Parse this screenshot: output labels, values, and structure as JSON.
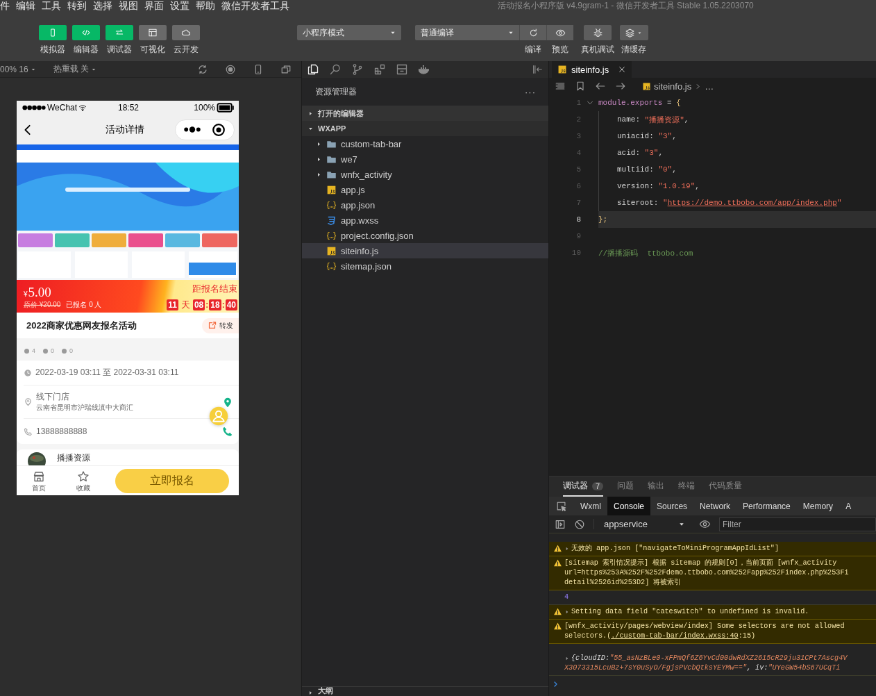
{
  "menu_bar": {
    "menus": [
      "件",
      "编辑",
      "工具",
      "转到",
      "选择",
      "视图",
      "界面",
      "设置",
      "帮助",
      "微信开发者工具"
    ],
    "title": "活动报名小程序版 v4.9gram-1 - 微信开发者工具 Stable 1.05.2203070"
  },
  "toolbar": {
    "view_buttons": [
      {
        "label": "模拟器",
        "selected": true
      },
      {
        "label": "编辑器",
        "selected": true
      },
      {
        "label": "调试器",
        "selected": true
      },
      {
        "label": "可视化",
        "selected": false
      },
      {
        "label": "云开发",
        "selected": false
      }
    ],
    "mode": "小程序模式",
    "compile_mode": "普通编译",
    "actions": [
      {
        "label": "编译",
        "kind": "joined"
      },
      {
        "label": "预览",
        "kind": "joined"
      },
      {
        "label": "真机调试",
        "kind": "single"
      },
      {
        "label": "清缓存",
        "kind": "menu"
      }
    ]
  },
  "simulator_bar": {
    "zoom": "00% 16",
    "hot_reload": "热重载 关"
  },
  "phone": {
    "carrier": "WeChat",
    "time": "18:52",
    "battery": "100%",
    "nav_title": "活动详情",
    "banner": {
      "kind": "picture"
    },
    "price": {
      "currency": "¥",
      "amount": "5.00",
      "original": "原价 ¥20.00",
      "signed_up": "已报名 0 人",
      "countdown_label": "距报名结束",
      "countdown": [
        {
          "t": "11",
          "kind": "box"
        },
        {
          "t": "天",
          "kind": "unit"
        },
        {
          "t": "08",
          "kind": "box"
        },
        {
          "t": ":",
          "kind": "sep"
        },
        {
          "t": "18",
          "kind": "box"
        },
        {
          "t": ":",
          "kind": "sep"
        },
        {
          "t": "40",
          "kind": "box"
        }
      ]
    },
    "title": "2022商家优惠网友报名活动",
    "share": "转发",
    "stats": [
      "4",
      "0",
      "0"
    ],
    "date": "2022-03-19 03:11 至 2022-03-31 03:11",
    "venue": "线下门店",
    "address": "云南省昆明市沪瑞线滇中大商汇",
    "phone": "13888888888",
    "organizer": "播播资源",
    "tabbar": [
      {
        "label": "首页"
      },
      {
        "label": "收藏"
      }
    ],
    "cta": "立即报名"
  },
  "explorer": {
    "title": "资源管理器",
    "more": "···",
    "sections": [
      {
        "label": "打开的编辑器",
        "expanded": false
      },
      {
        "label": "WXAPP",
        "expanded": true
      }
    ],
    "files": [
      {
        "name": "custom-tab-bar",
        "kind": "folder",
        "selected": false
      },
      {
        "name": "we7",
        "kind": "folder",
        "selected": false
      },
      {
        "name": "wnfx_activity",
        "kind": "folder",
        "selected": false
      },
      {
        "name": "app.js",
        "kind": "js",
        "selected": false
      },
      {
        "name": "app.json",
        "kind": "json",
        "selected": false
      },
      {
        "name": "app.wxss",
        "kind": "css",
        "selected": false
      },
      {
        "name": "project.config.json",
        "kind": "json",
        "selected": false
      },
      {
        "name": "siteinfo.js",
        "kind": "js",
        "selected": true
      },
      {
        "name": "sitemap.json",
        "kind": "json",
        "selected": false
      }
    ],
    "outline": "大纲"
  },
  "editor": {
    "tab": "siteinfo.js",
    "breadcrumb": "siteinfo.js",
    "breadcrumb_more": "…",
    "lines": [
      {
        "number": "1",
        "selected": false,
        "indented": false,
        "tokens": [
          {
            "t": "module.exports",
            "kind": "keyword"
          },
          {
            "t": " = ",
            "kind": "plain"
          },
          {
            "t": "{",
            "kind": "brace"
          }
        ]
      },
      {
        "number": "2",
        "selected": false,
        "indented": true,
        "tokens": [
          {
            "t": "name: ",
            "kind": "plain"
          },
          {
            "t": "\"播播资源\"",
            "kind": "string"
          },
          {
            "t": ",",
            "kind": "plain"
          }
        ]
      },
      {
        "number": "3",
        "selected": false,
        "indented": true,
        "tokens": [
          {
            "t": "uniacid: ",
            "kind": "plain"
          },
          {
            "t": "\"3\"",
            "kind": "string"
          },
          {
            "t": ",",
            "kind": "plain"
          }
        ]
      },
      {
        "number": "4",
        "selected": false,
        "indented": true,
        "tokens": [
          {
            "t": "acid: ",
            "kind": "plain"
          },
          {
            "t": "\"3\"",
            "kind": "string"
          },
          {
            "t": ",",
            "kind": "plain"
          }
        ]
      },
      {
        "number": "5",
        "selected": false,
        "indented": true,
        "tokens": [
          {
            "t": "multiid: ",
            "kind": "plain"
          },
          {
            "t": "\"0\"",
            "kind": "string"
          },
          {
            "t": ",",
            "kind": "plain"
          }
        ]
      },
      {
        "number": "6",
        "selected": false,
        "indented": true,
        "tokens": [
          {
            "t": "version: ",
            "kind": "plain"
          },
          {
            "t": "\"1.0.19\"",
            "kind": "string"
          },
          {
            "t": ",",
            "kind": "plain"
          }
        ]
      },
      {
        "number": "7",
        "selected": false,
        "indented": true,
        "tokens": [
          {
            "t": "siteroot: ",
            "kind": "plain"
          },
          {
            "t": "\"",
            "kind": "string"
          },
          {
            "t": "https://demo.ttbobo.com/app/index.php",
            "kind": "link"
          },
          {
            "t": "\"",
            "kind": "string"
          }
        ]
      },
      {
        "number": "8",
        "selected": true,
        "indented": false,
        "tokens": [
          {
            "t": "};",
            "kind": "brace"
          }
        ]
      },
      {
        "number": "9",
        "selected": false,
        "indented": false
      },
      {
        "number": "10",
        "selected": false,
        "indented": false,
        "tokens": [
          {
            "t": "//播播源码  ttbobo.com",
            "kind": "comment"
          }
        ]
      }
    ]
  },
  "debugger": {
    "panel_tabs": [
      {
        "label": "调试器",
        "selected": true,
        "badge": "7"
      },
      {
        "label": "问题",
        "selected": false
      },
      {
        "label": "输出",
        "selected": false
      },
      {
        "label": "终端",
        "selected": false
      },
      {
        "label": "代码质量",
        "selected": false
      }
    ],
    "devtools_tabs": [
      {
        "label": "Wxml",
        "selected": false
      },
      {
        "label": "Console",
        "selected": true
      },
      {
        "label": "Sources",
        "selected": false
      },
      {
        "label": "Network",
        "selected": false
      },
      {
        "label": "Performance",
        "selected": false
      },
      {
        "label": "Memory",
        "selected": false
      },
      {
        "label": "A",
        "selected": false
      }
    ],
    "context": "appservice",
    "filter_placeholder": "Filter",
    "messages": [
      {
        "kind": "warning",
        "expandable": true,
        "lines": [
          [
            {
              "t": "无效的 app.json [\"navigateToMiniProgramAppIdList\"]",
              "kind": "text"
            }
          ]
        ]
      },
      {
        "kind": "warning",
        "expandable": false,
        "lines": [
          [
            {
              "t": "[sitemap 索引情况提示] 根据 sitemap 的规则[0]，当前页面 [wnfx_activity",
              "kind": "text"
            }
          ],
          [
            {
              "t": "url=https%253A%252F%252Fdemo.ttbobo.com%252Fapp%252Findex.php%253Fi",
              "kind": "text"
            }
          ],
          [
            {
              "t": "detail%2526id%253D2] 将被索引",
              "kind": "text"
            }
          ]
        ]
      },
      {
        "kind": "log",
        "expandable": false,
        "lines": [
          [
            {
              "t": "4",
              "kind": "number"
            }
          ]
        ]
      },
      {
        "kind": "warning",
        "expandable": true,
        "lines": [
          [
            {
              "t": "Setting data field \"cateswitch\" to undefined is invalid.",
              "kind": "text"
            }
          ]
        ]
      },
      {
        "kind": "warning",
        "expandable": false,
        "lines": [
          [
            {
              "t": "[wnfx_activity/pages/webview/index] Some selectors are not allowed",
              "kind": "text"
            }
          ],
          [
            {
              "t": "selectors.(",
              "kind": "text"
            },
            {
              "t": "./custom-tab-bar/index.wxss:40",
              "kind": "link"
            },
            {
              "t": ":15)",
              "kind": "text"
            }
          ]
        ]
      },
      {
        "kind": "object",
        "expandable": true,
        "lines": [
          [
            {
              "t": "{cloudID: ",
              "kind": "key"
            },
            {
              "t": "\"55_asNzBLe0-xFPmQf6Z6YvCd00dwRdXZ2615cR29ju31CPt7Ascg4V",
              "kind": "string"
            }
          ],
          [
            {
              "t": "X3073315LcuBz+7sY0uSyO/FgjsPVcbQtksYEYMw==\"",
              "kind": "string"
            },
            {
              "t": ", iv: ",
              "kind": "key"
            },
            {
              "t": "\"UYeGW54bS67UCqTi",
              "kind": "string"
            }
          ]
        ]
      }
    ]
  }
}
